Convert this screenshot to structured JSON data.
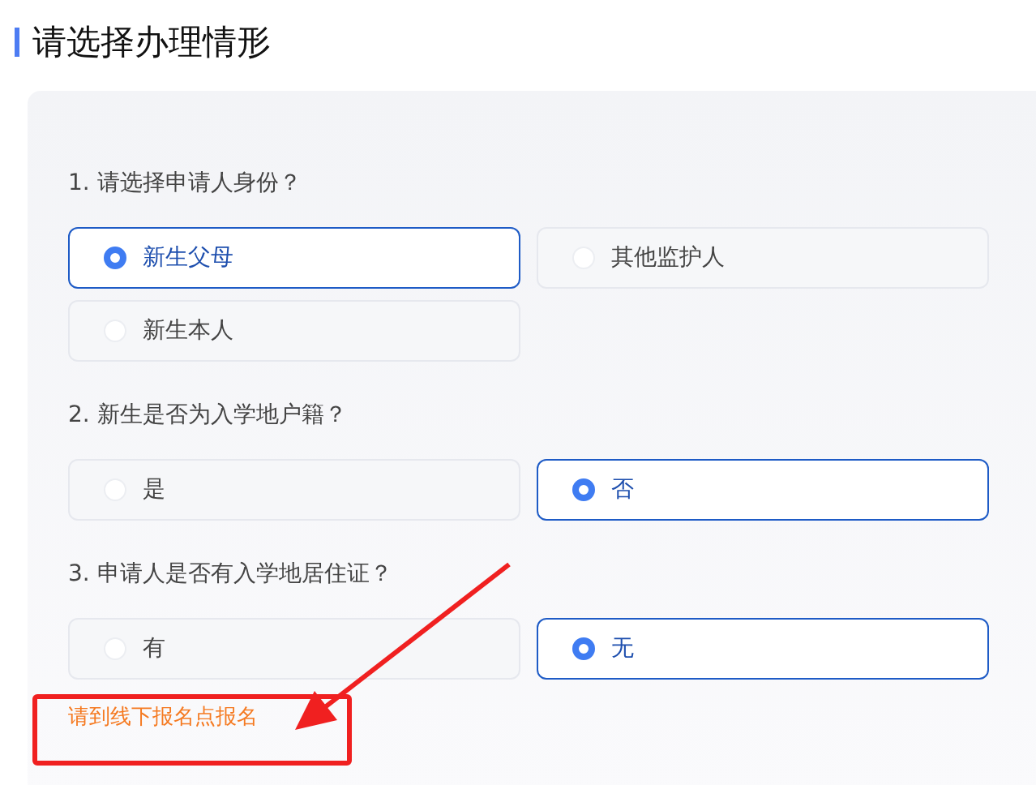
{
  "title": "请选择办理情形",
  "questions": [
    {
      "label": "1. 请选择申请人身份？",
      "options": [
        {
          "label": "新生父母",
          "selected": true
        },
        {
          "label": "其他监护人",
          "selected": false
        },
        {
          "label": "新生本人",
          "selected": false
        }
      ]
    },
    {
      "label": "2. 新生是否为入学地户籍？",
      "options": [
        {
          "label": "是",
          "selected": false
        },
        {
          "label": "否",
          "selected": true
        }
      ]
    },
    {
      "label": "3. 申请人是否有入学地居住证？",
      "options": [
        {
          "label": "有",
          "selected": false
        },
        {
          "label": "无",
          "selected": true
        }
      ]
    }
  ],
  "notice": "请到线下报名点报名"
}
